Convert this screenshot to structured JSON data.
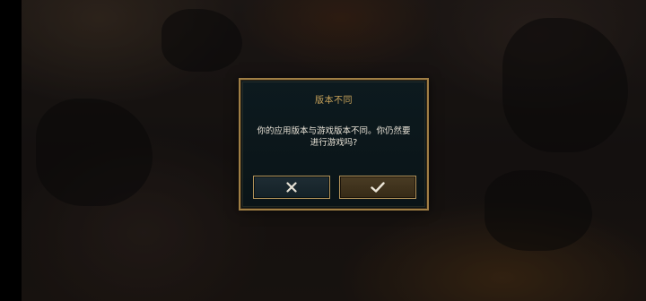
{
  "dialog": {
    "title": "版本不同",
    "message_line1": "你的应用版本与游戏版本不同。你仍然要",
    "message_line2": "进行游戏吗?"
  },
  "buttons": {
    "cancel_icon": "close-icon",
    "confirm_icon": "checkmark-icon"
  },
  "colors": {
    "accent_gold": "#c8a35a",
    "border_gold": "#a07f45",
    "dialog_bg": "#0d1a1f",
    "text": "#e8e2d6"
  }
}
